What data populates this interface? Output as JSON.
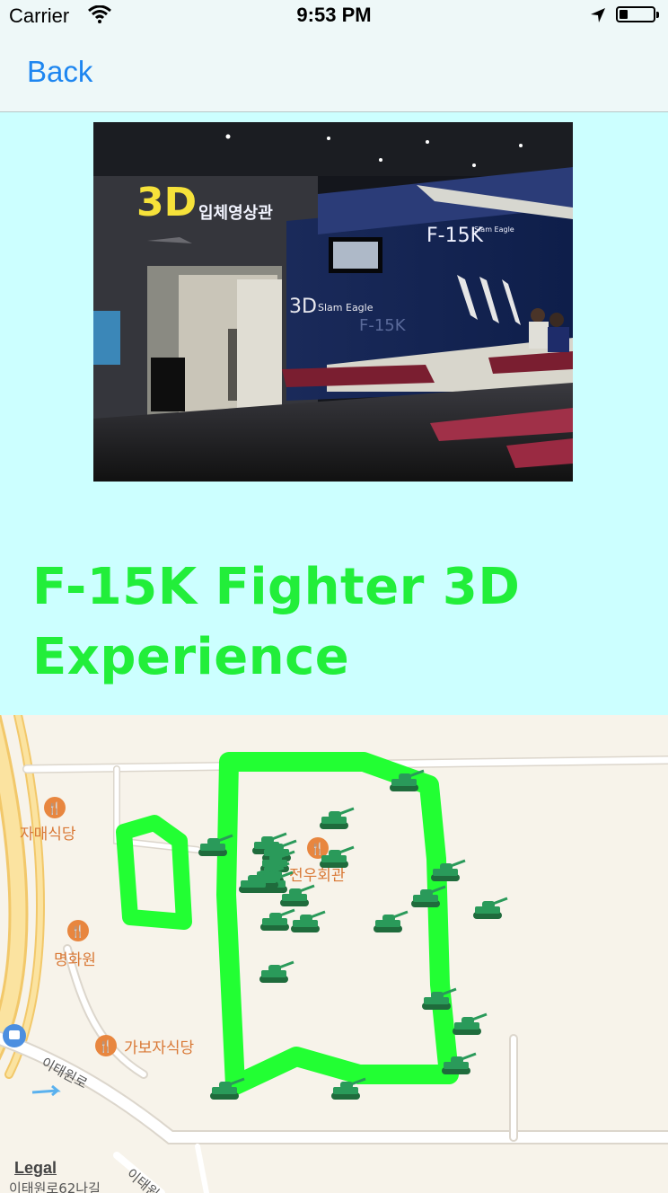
{
  "status_bar": {
    "carrier": "Carrier",
    "time": "9:53 PM",
    "battery_level": 0.25
  },
  "nav": {
    "back_label": "Back"
  },
  "photo": {
    "sign_3d": "3D",
    "sign_korean": "입체영상관",
    "sign_f15k": "F-15K",
    "sign_slam_eagle": "Slam Eagle",
    "sign_3d_small": "3D",
    "sign_slam_eagle_small": "Slam Eagle",
    "sign_f15k_faint": "F-15K"
  },
  "title": "F-15K Fighter 3D Experience",
  "map": {
    "pois": [
      {
        "name": "자매식당"
      },
      {
        "name": "전우회관"
      },
      {
        "name": "명화원"
      },
      {
        "name": "가보자식당"
      }
    ],
    "streets": [
      "이태원로",
      "이태원로62나길",
      "이태원"
    ],
    "legal_label": "Legal",
    "colors": {
      "route": "#22ff33",
      "tank": "#2a9a5a",
      "poi": "#e8863f"
    },
    "marker_icon": "tank-icon",
    "marker_count": 24
  }
}
